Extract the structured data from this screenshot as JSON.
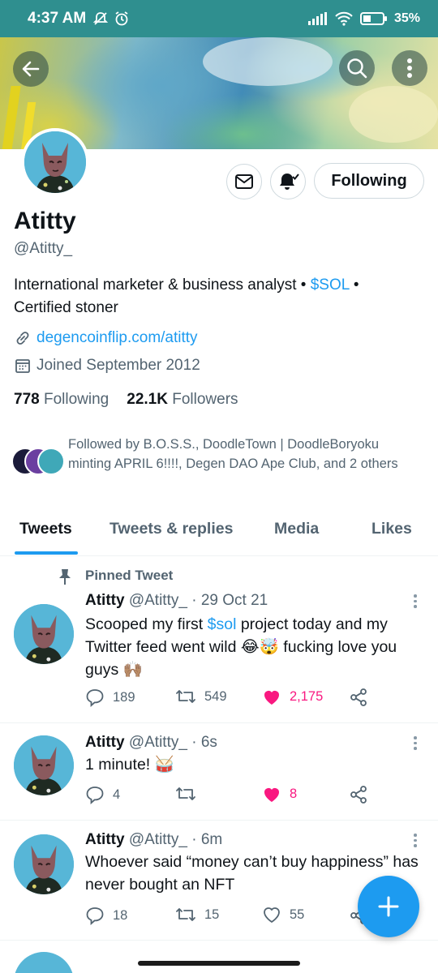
{
  "status_bar": {
    "time": "4:37 AM",
    "battery": "35%"
  },
  "profile": {
    "display_name": "Atitty",
    "handle": "@Atitty_",
    "bio_prefix": "International marketer & business analyst • ",
    "bio_cashtag": "$SOL",
    "bio_suffix": " • Certified stoner",
    "link": "degencoinflip.com/atitty",
    "joined": "Joined September 2012",
    "following_count": "778",
    "following_label": "Following",
    "followers_count": "22.1K",
    "followers_label": "Followers",
    "followed_by": "Followed by B.O.S.S., DoodleTown | DoodleBoryoku minting APRIL 6!!!!, Degen DAO Ape Club, and 2 others",
    "follow_button": "Following"
  },
  "tabs": [
    "Tweets",
    "Tweets & replies",
    "Media",
    "Likes"
  ],
  "pinned_label": "Pinned Tweet",
  "tweets": [
    {
      "name": "Atitty",
      "handle": "@Atitty_",
      "time": "· 29 Oct 21",
      "text_a": "Scooped my first ",
      "cashtag": "$sol",
      "text_b": " project today and my Twitter feed went wild 😂🤯 fucking love you guys 🙌🏽",
      "replies": "189",
      "retweets": "549",
      "likes": "2,175"
    },
    {
      "name": "Atitty",
      "handle": "@Atitty_",
      "time": "· 6s",
      "text": "1 minute! 🥁",
      "replies": "4",
      "retweets": "",
      "likes": "8"
    },
    {
      "name": "Atitty",
      "handle": "@Atitty_",
      "time": "· 6m",
      "text": "Whoever said “money can’t buy happiness” has never bought an NFT",
      "replies": "18",
      "retweets": "15",
      "likes": "55"
    }
  ],
  "colors": {
    "accent": "#1d9bf0",
    "like": "#f91880",
    "statusbar": "#2f8f8f"
  }
}
